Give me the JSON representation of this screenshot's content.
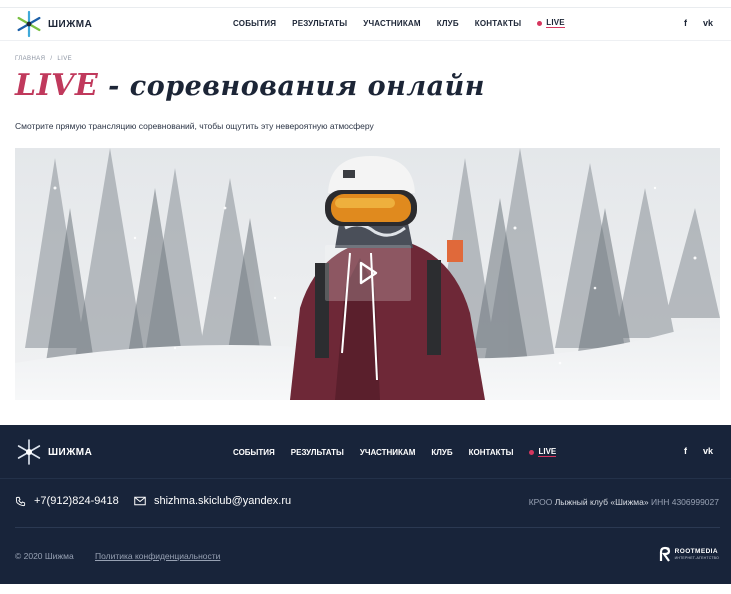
{
  "header": {
    "logo_text": "ШИЖМА",
    "nav": [
      {
        "label": "СОБЫТИЯ"
      },
      {
        "label": "РЕЗУЛЬТАТЫ"
      },
      {
        "label": "УЧАСТНИКАМ"
      },
      {
        "label": "КЛУБ"
      },
      {
        "label": "КОНТАКТЫ"
      }
    ],
    "live_label": "LIVE",
    "socials": {
      "facebook": "f",
      "vk": "vk"
    }
  },
  "breadcrumb": {
    "home": "ГЛАВНАЯ",
    "separator": "/",
    "current": "LIVE"
  },
  "page": {
    "title_accent": "LIVE",
    "title_rest": " - соревнования онлайн",
    "subtitle": "Смотрите прямую трансляцию соревнований, чтобы ощутить эту невероятную атмосферу"
  },
  "video": {
    "play_icon": "play-icon"
  },
  "footer": {
    "logo_text": "ШИЖМА",
    "nav": [
      {
        "label": "СОБЫТИЯ"
      },
      {
        "label": "РЕЗУЛЬТАТЫ"
      },
      {
        "label": "УЧАСТНИКАМ"
      },
      {
        "label": "КЛУБ"
      },
      {
        "label": "КОНТАКТЫ"
      }
    ],
    "live_label": "LIVE",
    "socials": {
      "facebook": "f",
      "vk": "vk"
    },
    "phone": "+7(912)824-9418",
    "email": "shizhma.skiclub@yandex.ru",
    "org_prefix": "КРОО ",
    "org_name": "Лыжный клуб «Шижма»",
    "org_inn": " ИНН 4306999027",
    "copyright": "© 2020 Шижма",
    "privacy": "Политика конфиденциальности",
    "developer_name": "ROOTMEDIA",
    "developer_sub": "ИНТЕРНЕТ-АГЕНТСТВО"
  },
  "colors": {
    "accent": "#d6365e",
    "title_accent": "#c0395c",
    "dark": "#1c2536",
    "footer_bg": "#18243a"
  }
}
